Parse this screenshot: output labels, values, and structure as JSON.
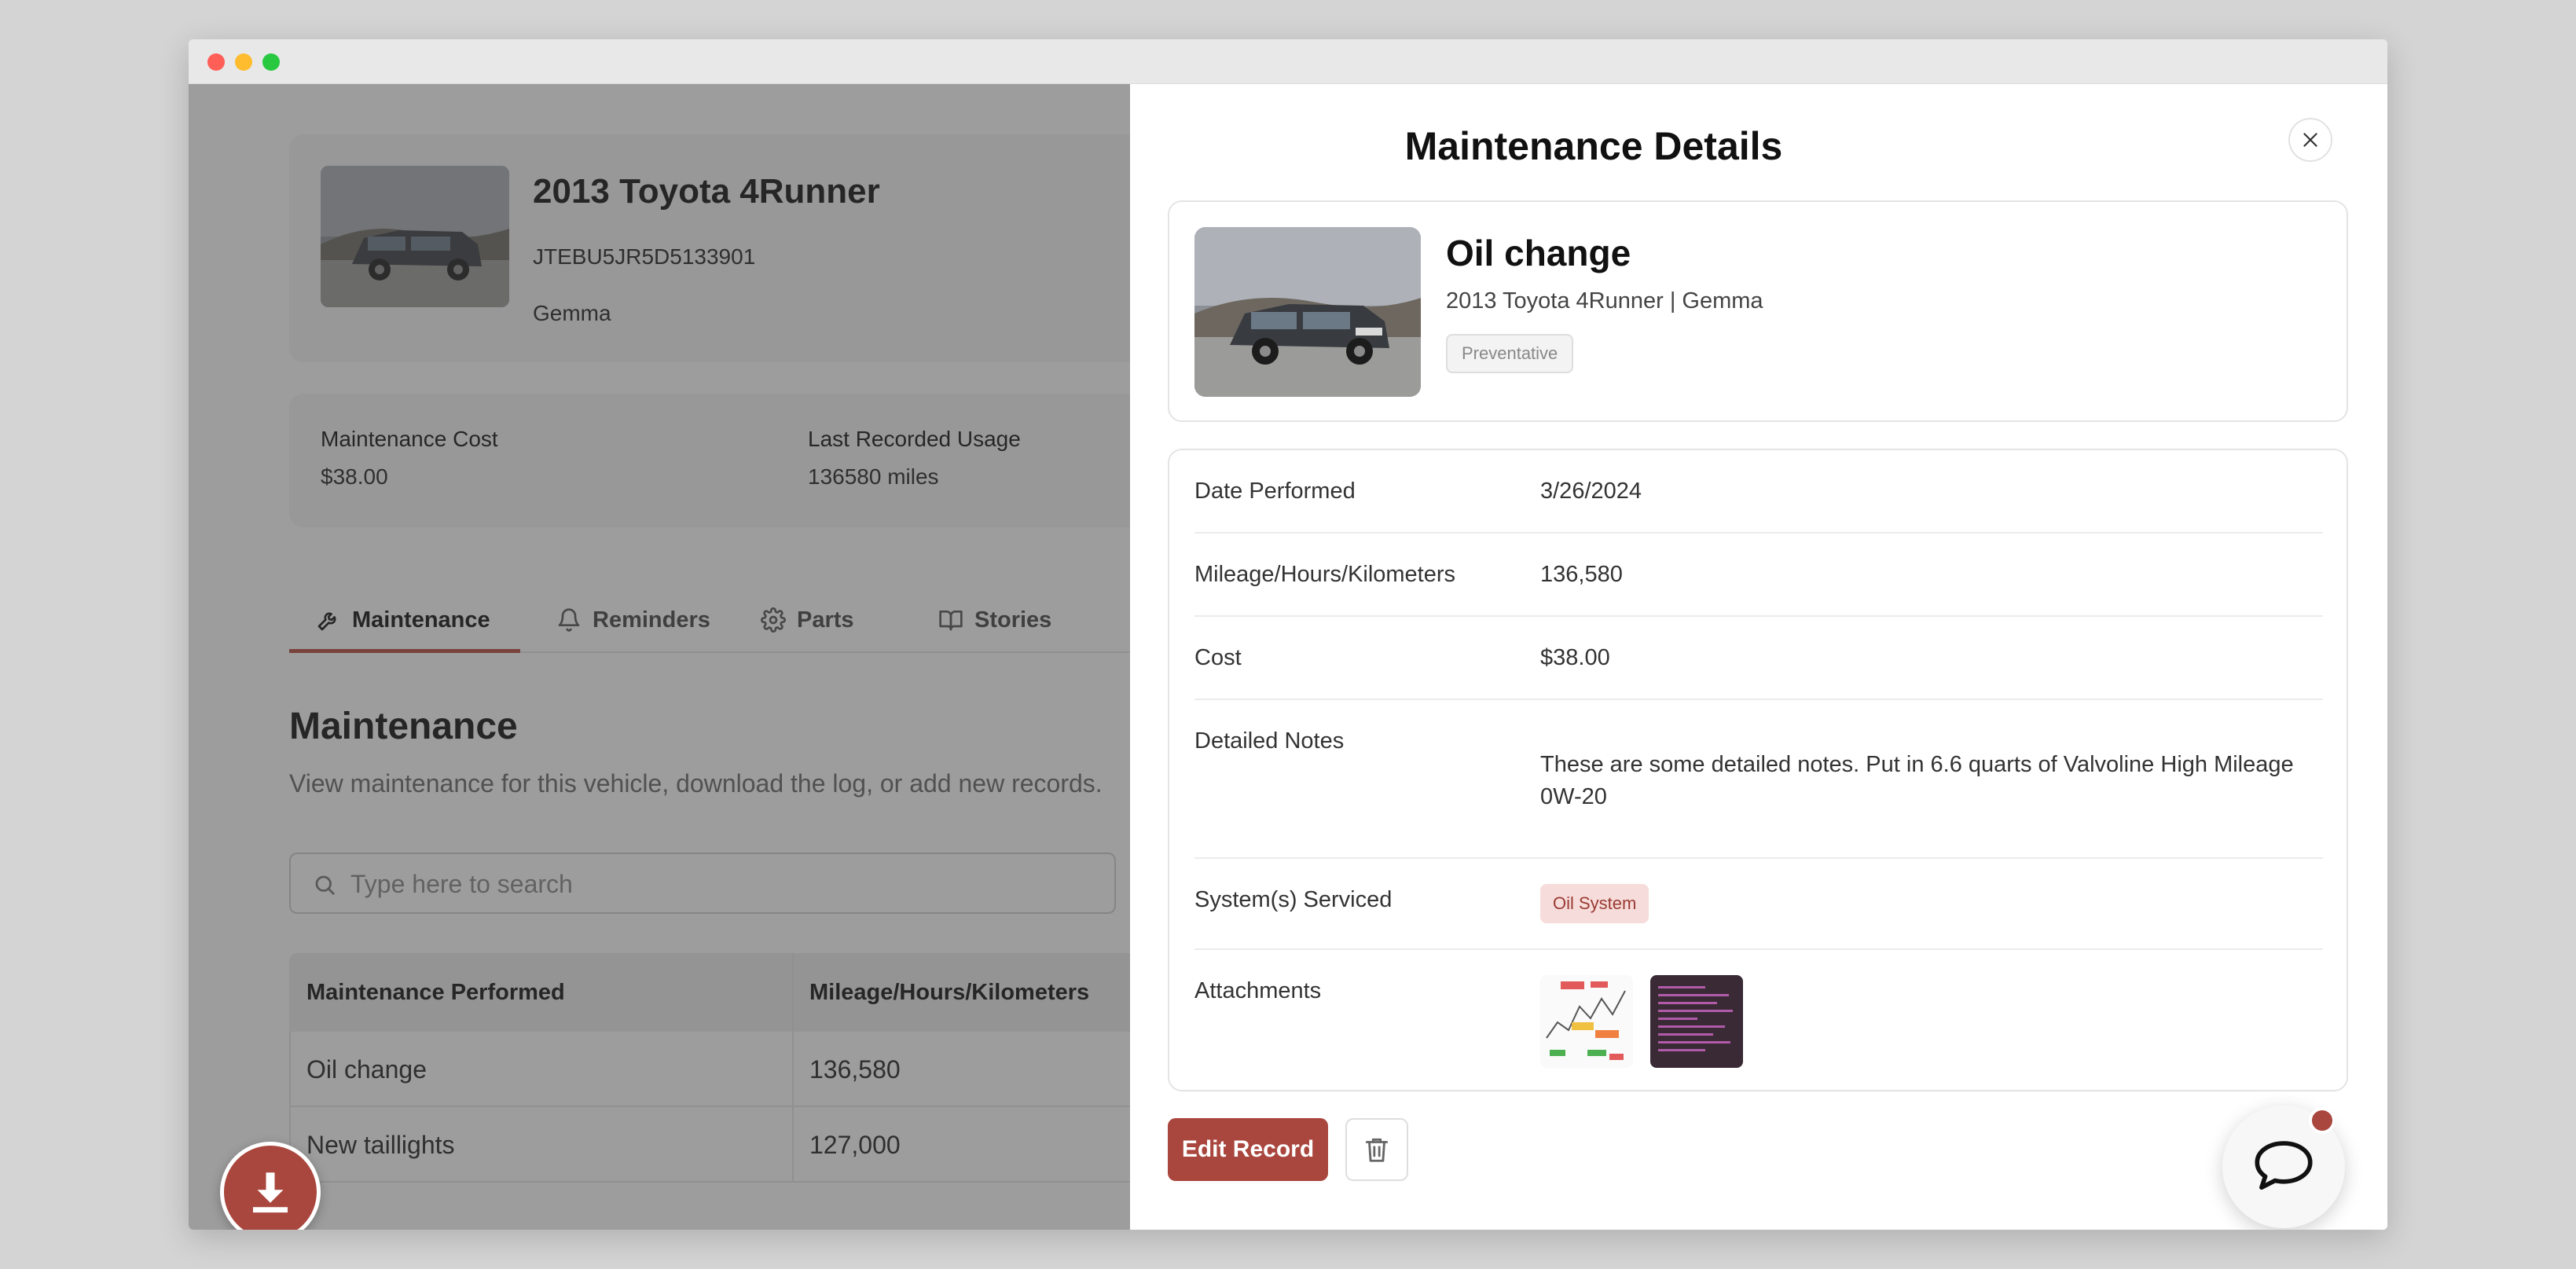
{
  "vehicle": {
    "name": "2013 Toyota 4Runner",
    "vin": "JTEBU5JR5D5133901",
    "owner": "Gemma"
  },
  "stats": {
    "cost_label": "Maintenance Cost",
    "cost_value": "$38.00",
    "usage_label": "Last Recorded Usage",
    "usage_value": "136580 miles"
  },
  "tabs": [
    {
      "label": "Maintenance",
      "icon": "wrench-icon",
      "active": true
    },
    {
      "label": "Reminders",
      "icon": "bell-icon"
    },
    {
      "label": "Parts",
      "icon": "gear-icon"
    },
    {
      "label": "Stories",
      "icon": "book-icon"
    }
  ],
  "maintenance": {
    "title": "Maintenance",
    "subtitle": "View maintenance for this vehicle, download the log, or add new records.",
    "search_placeholder": "Type here to search",
    "columns": [
      "Maintenance Performed",
      "Mileage/Hours/Kilometers"
    ],
    "rows": [
      [
        "Oil change",
        "136,580"
      ],
      [
        "New taillights",
        "127,000"
      ]
    ]
  },
  "drawer": {
    "title": "Maintenance Details",
    "record": {
      "name": "Oil change",
      "subtitle": "2013 Toyota 4Runner | Gemma",
      "category": "Preventative"
    },
    "details": {
      "date_label": "Date Performed",
      "date_value": "3/26/2024",
      "mileage_label": "Mileage/Hours/Kilometers",
      "mileage_value": "136,580",
      "cost_label": "Cost",
      "cost_value": "$38.00",
      "notes_label": "Detailed Notes",
      "notes_value": "These are some detailed notes. Put in 6.6 quarts of Valvoline High Mileage 0W-20",
      "systems_label": "System(s) Serviced",
      "systems_value": "Oil System",
      "attachments_label": "Attachments"
    },
    "edit_label": "Edit Record"
  },
  "colors": {
    "accent": "#a9463d",
    "tag_bg": "#f6dcda"
  }
}
